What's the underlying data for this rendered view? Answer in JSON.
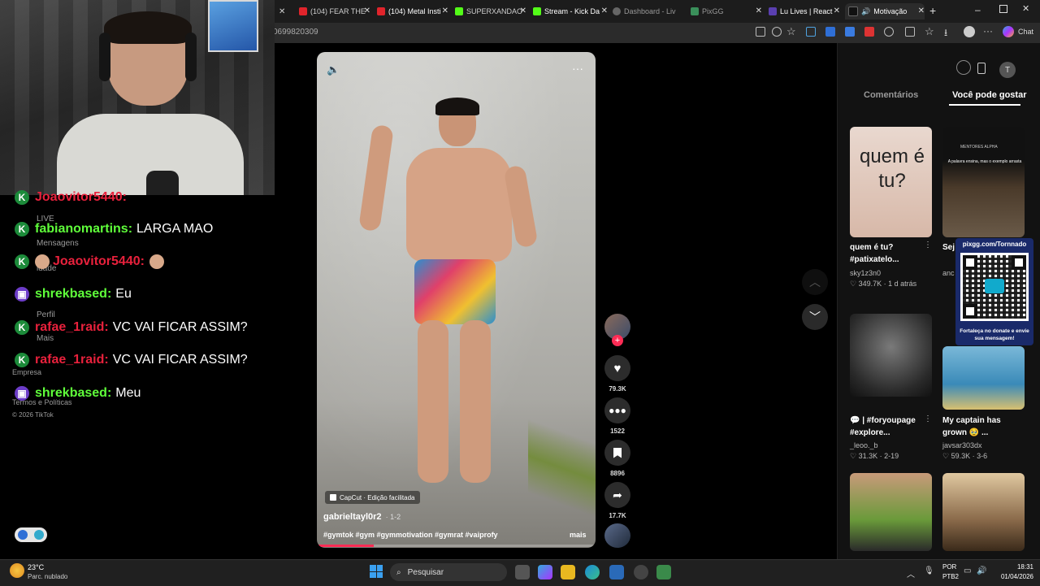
{
  "browser": {
    "tabs": [
      {
        "label": "(104) FEAR THE",
        "color": "#e0242b"
      },
      {
        "label": "(104) Metal Insti",
        "color": "#e0242b"
      },
      {
        "label": "SUPERXANDAO",
        "color": "#53fc18"
      },
      {
        "label": "Stream - Kick Da",
        "color": "#53fc18"
      },
      {
        "label": "Dashboard - Liv",
        "color": "#888888"
      },
      {
        "label": "PixGG",
        "color": "#3a8f5a"
      },
      {
        "label": "Lu Lives | React",
        "color": "#5a3fb0"
      },
      {
        "label": "Motivação",
        "color": "#222222"
      }
    ],
    "url": "0699820309",
    "chat_button": "Chat"
  },
  "left_nav": {
    "live": "LIVE",
    "messages": "Mensagens",
    "activity": "idade",
    "profile": "Perfil",
    "more": "Mais",
    "company": "Empresa",
    "terms": "Termos e Políticas",
    "copyright": "© 2026 TikTok"
  },
  "chat": [
    {
      "platform": "kick",
      "user": "Joaovitor5440:",
      "msg": "",
      "color": "#e8213c"
    },
    {
      "platform": "kick",
      "user": "fabianomartins:",
      "msg": "LARGA MAO",
      "color": "#5fff3a"
    },
    {
      "platform": "kick",
      "user": "Joaovitor5440:",
      "msg": "",
      "color": "#e8213c"
    },
    {
      "platform": "twitch",
      "user": "shrekbased:",
      "msg": "Eu",
      "color": "#5fff3a"
    },
    {
      "platform": "kick",
      "user": "rafae_1raid:",
      "msg": "VC VAI FICAR ASSIM?",
      "color": "#e8213c"
    },
    {
      "platform": "kick",
      "user": "rafae_1raid:",
      "msg": "VC VAI FICAR ASSIM?",
      "color": "#e8213c"
    },
    {
      "platform": "twitch",
      "user": "shrekbased:",
      "msg": "Meu",
      "color": "#5fff3a"
    }
  ],
  "video": {
    "effect_label": "CapCut · Edição facilitada",
    "author": "gabrieltayl0r2",
    "part": "· 1-2",
    "caption": "#gymtok #gym #gymmotivation #gymrat #vaiprofy",
    "more": "mais",
    "likes": "79.3K",
    "comments": "1522",
    "saves": "8896",
    "shares": "17.7K"
  },
  "right_panel": {
    "tab_comments": "Comentários",
    "tab_suggest": "Você pode gostar",
    "avatar_letter": "T",
    "thumb1_text": "quem é tu?",
    "thumb2_header": "MENTORES ALPHA",
    "thumb2_quote": "A palavra ensina, mas o exemplo arrasta",
    "cards": [
      {
        "title": "quem é tu? #patixatelo...",
        "user": "sky1z3n0",
        "likes": "349.7K",
        "date": "1 d atrás"
      },
      {
        "title": "Sej seu",
        "user": "anc",
        "likes": "",
        "date": ""
      },
      {
        "title": "💬 | #foryoupage #explore...",
        "user": "_leoo._b",
        "likes": "31.3K",
        "date": "2-19"
      },
      {
        "title": "My captain has grown 🥹 ...",
        "user": "javsar303dx",
        "likes": "59.3K",
        "date": "3-6"
      }
    ]
  },
  "pixgg": {
    "url": "pixgg.com/Tornnado",
    "cta": "Fortaleça no donate e envie sua mensagem!"
  },
  "taskbar": {
    "temp": "23°C",
    "weather": "Parc. nublado",
    "search": "Pesquisar",
    "lang1": "POR",
    "lang2": "PTB2",
    "time": "18:31",
    "date": "01/04/2026"
  }
}
